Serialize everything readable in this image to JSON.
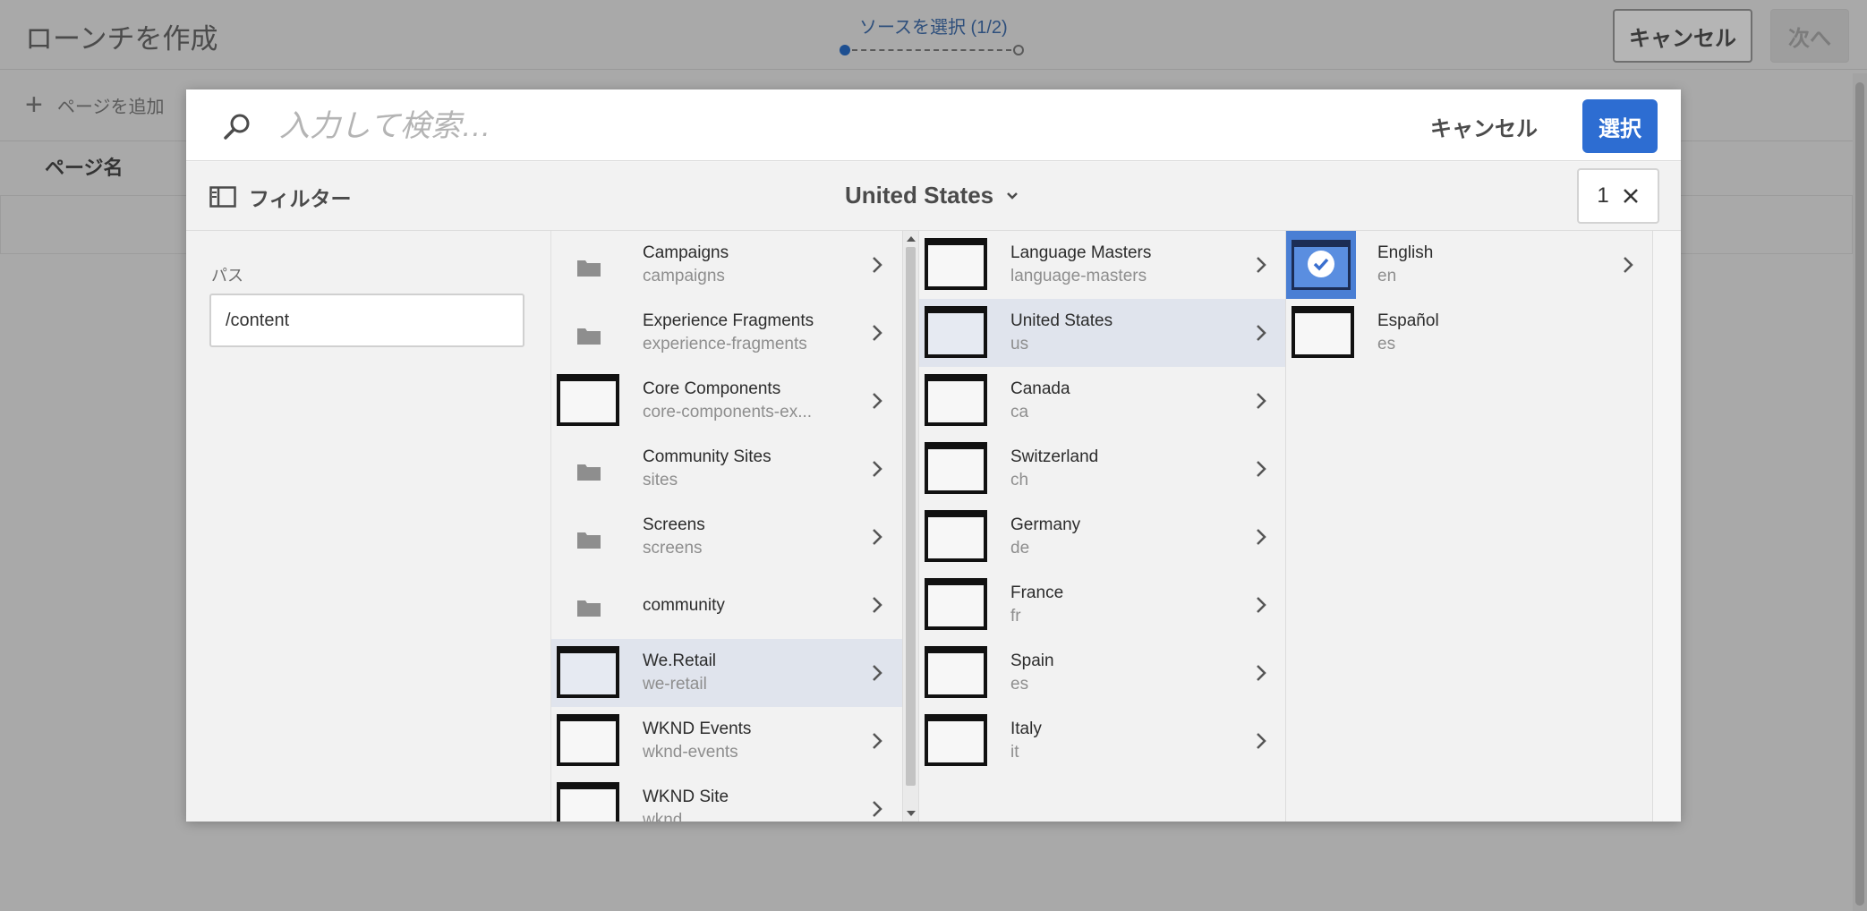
{
  "background": {
    "title": "ローンチを作成",
    "step_label": "ソースを選択 (1/2)",
    "cancel_label": "キャンセル",
    "next_label": "次へ",
    "add_page_label": "ページを追加",
    "column_header": "ページ名"
  },
  "modal": {
    "search_placeholder": "入力して検索…",
    "cancel_label": "キャンセル",
    "select_label": "選択",
    "filter_label": "フィルター",
    "breadcrumb": "United States",
    "selection_count": "1",
    "path_label": "パス",
    "path_value": "/content"
  },
  "column1": [
    {
      "title": "Campaigns",
      "sub": "campaigns",
      "icon": "folder-icon"
    },
    {
      "title": "Experience Fragments",
      "sub": "experience-fragments",
      "icon": "folder-icon"
    },
    {
      "title": "Core Components",
      "sub": "core-components-ex...",
      "icon": "page-thumbnail"
    },
    {
      "title": "Community Sites",
      "sub": "sites",
      "icon": "folder-icon"
    },
    {
      "title": "Screens",
      "sub": "screens",
      "icon": "folder-icon"
    },
    {
      "title": "community",
      "sub": "",
      "icon": "folder-icon"
    },
    {
      "title": "We.Retail",
      "sub": "we-retail",
      "icon": "page-thumbnail",
      "selected": true
    },
    {
      "title": "WKND Events",
      "sub": "wknd-events",
      "icon": "page-thumbnail"
    },
    {
      "title": "WKND Site",
      "sub": "wknd",
      "icon": "page-thumbnail"
    }
  ],
  "column2": [
    {
      "title": "Language Masters",
      "sub": "language-masters"
    },
    {
      "title": "United States",
      "sub": "us",
      "selected": true
    },
    {
      "title": "Canada",
      "sub": "ca"
    },
    {
      "title": "Switzerland",
      "sub": "ch"
    },
    {
      "title": "Germany",
      "sub": "de"
    },
    {
      "title": "France",
      "sub": "fr"
    },
    {
      "title": "Spain",
      "sub": "es"
    },
    {
      "title": "Italy",
      "sub": "it"
    }
  ],
  "column3": [
    {
      "title": "English",
      "sub": "en",
      "checked": true
    },
    {
      "title": "Español",
      "sub": "es"
    }
  ]
}
